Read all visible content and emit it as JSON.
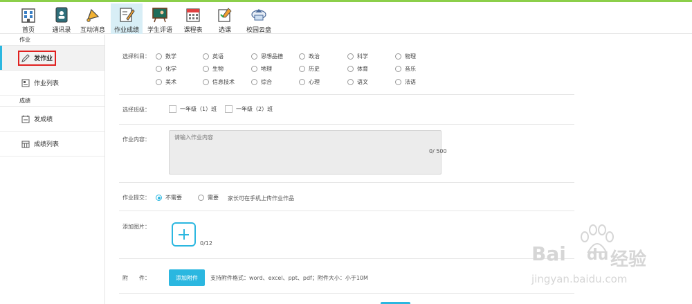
{
  "topnav": {
    "items": [
      {
        "label": "首页",
        "icon": "building-icon"
      },
      {
        "label": "通讯录",
        "icon": "contact-book-icon"
      },
      {
        "label": "互动消息",
        "icon": "bell-icon"
      },
      {
        "label": "作业成绩",
        "icon": "homework-icon",
        "active": true
      },
      {
        "label": "学生评语",
        "icon": "blackboard-icon"
      },
      {
        "label": "课程表",
        "icon": "calendar-icon"
      },
      {
        "label": "选课",
        "icon": "course-select-icon"
      },
      {
        "label": "校园云盘",
        "icon": "cloud-drive-icon"
      }
    ]
  },
  "sidebar": {
    "group1": "作业",
    "item_publish": "发作业",
    "item_list": "作业列表",
    "group2": "成绩",
    "item_grade_publish": "发成绩",
    "item_grade_list": "成绩列表"
  },
  "form": {
    "subject_label": "选择科目：",
    "subjects": [
      [
        "数学",
        "英语",
        "思想品德",
        "政治",
        "科学",
        "物理"
      ],
      [
        "化学",
        "生物",
        "地理",
        "历史",
        "体育",
        "音乐"
      ],
      [
        "美术",
        "信息技术",
        "综合",
        "心理",
        "语文",
        "法语"
      ]
    ],
    "class_label": "选择班级：",
    "classes": [
      "一年级（1）班",
      "一年级（2）班"
    ],
    "content_label": "作业内容：",
    "content_placeholder": "请输入作业内容",
    "content_counter": "0/ 500",
    "submit_label": "作业提交：",
    "submit_no": "不需要",
    "submit_yes": "需要",
    "submit_hint": "家长可在手机上传作业作品",
    "image_label": "添加图片：",
    "image_counter": "0/12",
    "attach_label": "附　　件：",
    "attach_button": "添加附件",
    "attach_hint": "支持附件格式：word、excel、ppt、pdf；附件大小：小于10M"
  },
  "watermark": {
    "brand": "Bai",
    "brand2": "du",
    "cn": "经验",
    "url": "jingyan.baidu.com"
  },
  "colors": {
    "accent": "#2bb7e0",
    "top_line": "#8ccf4a",
    "highlight_box": "#e0201f"
  }
}
